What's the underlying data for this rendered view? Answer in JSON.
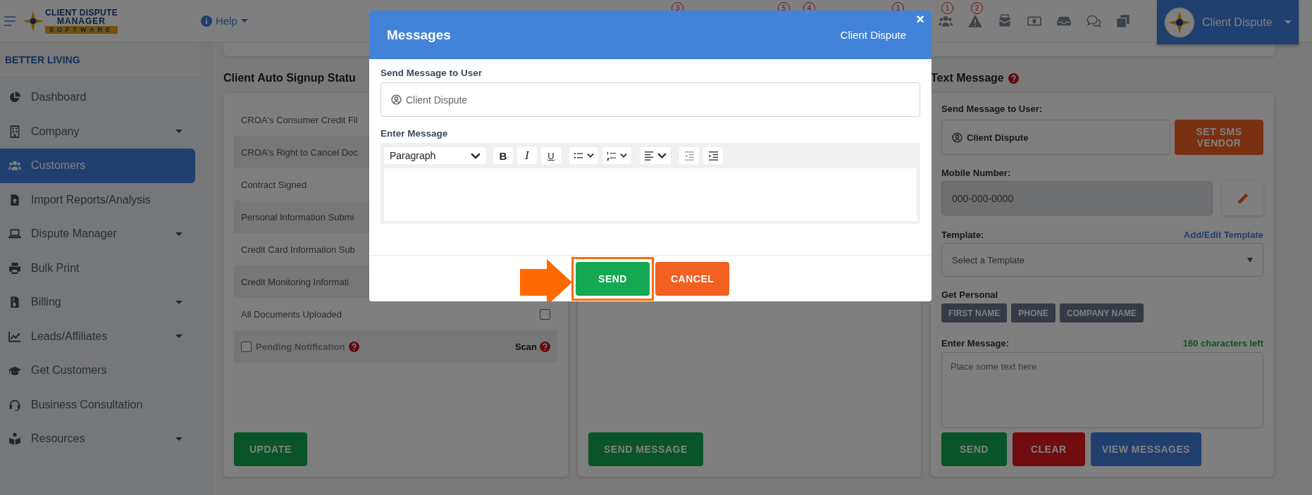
{
  "topbar": {
    "logo": {
      "line_1": "CLIENT DISPUTE",
      "line_2": "MANAGER",
      "line_3": "SOFTWARE"
    },
    "help": "Help",
    "partial_badges": [
      "3",
      "5",
      "4",
      "1"
    ],
    "badges": [
      "1",
      "2"
    ],
    "user": {
      "name": "Client Dispute"
    }
  },
  "sidebar": {
    "company": "BETTER LIVING",
    "items": [
      {
        "label": "Dashboard",
        "expandable": false,
        "selected": false
      },
      {
        "label": "Company",
        "expandable": true,
        "selected": false
      },
      {
        "label": "Customers",
        "expandable": false,
        "selected": true
      },
      {
        "label": "Import Reports/Analysis",
        "expandable": false,
        "selected": false
      },
      {
        "label": "Dispute Manager",
        "expandable": true,
        "selected": false
      },
      {
        "label": "Bulk Print",
        "expandable": false,
        "selected": false
      },
      {
        "label": "Billing",
        "expandable": true,
        "selected": false
      },
      {
        "label": "Leads/Affiliates",
        "expandable": true,
        "selected": false
      },
      {
        "label": "Get Customers",
        "expandable": false,
        "selected": false
      },
      {
        "label": "Business Consultation",
        "expandable": false,
        "selected": false
      },
      {
        "label": "Resources",
        "expandable": true,
        "selected": false
      }
    ]
  },
  "signup_status": {
    "title": "Client Auto Signup Statu",
    "rows": [
      "CROA's Consumer Credit Fil",
      "CROA's Right to Cancel Doc",
      "Contract Signed",
      "Personal Information Submi",
      "Credit Card Information Sub",
      "Credit Monitoring Informati"
    ],
    "all_documents": {
      "label": "All Documents Uploaded",
      "checked": false
    },
    "pending_notification": {
      "label": "Pending Notification",
      "checked": false,
      "scan": "Scan"
    },
    "button": "UPDATE"
  },
  "message_panel": {
    "button": "SEND MESSAGE"
  },
  "text_message": {
    "title": "Text Message",
    "user_label": "Send Message to User:",
    "user": "Client Dispute",
    "vendor_button": "SET SMS VENDOR",
    "mobile_label": "Mobile Number:",
    "mobile": {
      "value": "000-000-0000",
      "disabled": true
    },
    "template_label": "Template:",
    "template_link": "Add/Edit Template",
    "template_placeholder": "Select a Template",
    "personal_label": "Get Personal",
    "chips": [
      "FIRST NAME",
      "PHONE",
      "COMPANY NAME"
    ],
    "message_label": "Enter Message:",
    "chars_left": "160 characters left",
    "message_placeholder": "Place some text here",
    "buttons": [
      "SEND",
      "CLEAR",
      "VIEW MESSAGES"
    ]
  },
  "modal": {
    "title": "Messages",
    "subtitle": "Client Dispute",
    "close": "×",
    "user_label": "Send Message to User",
    "user": "Client Dispute",
    "message_label": "Enter Message",
    "format": "Paragraph",
    "format_buttons": [
      "B",
      "I",
      "U"
    ],
    "send": "SEND",
    "cancel": "CANCEL"
  }
}
